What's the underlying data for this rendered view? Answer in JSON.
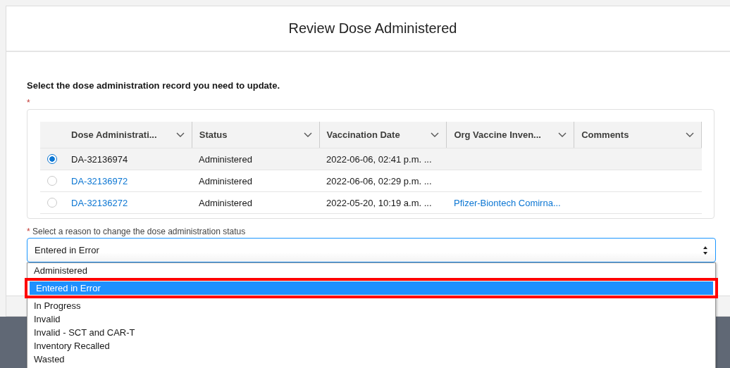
{
  "modal": {
    "title": "Review Dose Administered"
  },
  "instruction": "Select the dose administration record you need to update.",
  "record_required": true,
  "record_required_mark": "*",
  "table": {
    "columns": [
      {
        "label": "Dose Administrati..."
      },
      {
        "label": "Status"
      },
      {
        "label": "Vaccination Date"
      },
      {
        "label": "Org Vaccine Inven..."
      },
      {
        "label": "Comments"
      }
    ],
    "rows": [
      {
        "selected": true,
        "record": "DA-32136974",
        "record_linked": false,
        "status": "Administered",
        "vaccination_date": "2022-06-06, 02:41 p.m. ..."
      },
      {
        "selected": false,
        "record": "DA-32136972",
        "record_linked": true,
        "status": "Administered",
        "vaccination_date": "2022-06-06, 02:29 p.m. ..."
      },
      {
        "selected": false,
        "record": "DA-32136272",
        "record_linked": true,
        "status": "Administered",
        "vaccination_date": "2022-05-20, 10:19 a.m. ...",
        "org_inventory": "Pfizer-Biontech Comirna..."
      }
    ]
  },
  "reason": {
    "label": "Select a reason to change the dose administration status",
    "required": true,
    "required_mark": "*",
    "value": "Entered in Error",
    "options": [
      {
        "label": "Administered",
        "selected": false,
        "highlighted": false
      },
      {
        "label": "Entered in Error",
        "selected": true,
        "highlighted": true
      },
      {
        "label": "In Progress",
        "selected": false,
        "highlighted": false
      },
      {
        "label": "Invalid",
        "selected": false,
        "highlighted": false
      },
      {
        "label": "Invalid - SCT and CAR-T",
        "selected": false,
        "highlighted": false
      },
      {
        "label": "Inventory Recalled",
        "selected": false,
        "highlighted": false
      },
      {
        "label": "Wasted",
        "selected": false,
        "highlighted": false
      }
    ]
  }
}
